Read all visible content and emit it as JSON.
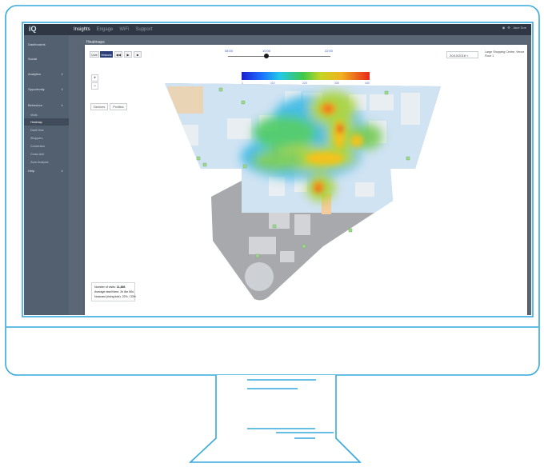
{
  "topbar": {
    "logo": "iQ",
    "nav": [
      "Insights",
      "Engage",
      "WiFi",
      "Support"
    ],
    "active_nav": "Insights",
    "user": "Jane Doe"
  },
  "sidebar": {
    "items": [
      {
        "label": "Dashboards",
        "chevron": ""
      },
      {
        "label": "Social",
        "chevron": ""
      },
      {
        "label": "Analytics",
        "chevron": "∨"
      },
      {
        "label": "Opportunity",
        "chevron": "∨"
      },
      {
        "label": "Behaviour",
        "chevron": "∧"
      }
    ],
    "sub_items": [
      "Visits",
      "Heatmap",
      "Dwell time",
      "Shoppers",
      "Conversion",
      "Cross-visit",
      "Zone Analysis"
    ],
    "selected_sub": "Heatmap",
    "last_item": {
      "label": "Help",
      "chevron": "∨"
    }
  },
  "content": {
    "page_title": "Heatmaps"
  },
  "controls": {
    "live_label": "Live",
    "historic_label": "Historic",
    "rewind_icon": "◀◀",
    "play_icon": "▶",
    "stop_icon": "■",
    "zoom_in": "+",
    "zoom_out": "−",
    "mode_a": "Devices",
    "mode_b": "Profiles"
  },
  "timeline": {
    "start": "08:00",
    "current": "10:00",
    "end": "22:00",
    "position": 0.375
  },
  "scale": {
    "ticks": [
      "1",
      "110",
      "220",
      "330",
      "440"
    ],
    "colors": [
      "#1b1fcf",
      "#1d6cff",
      "#22c9e8",
      "#3ec84a",
      "#c7d522",
      "#f1b11f",
      "#e8261a"
    ]
  },
  "filters": {
    "date": "20/10/2018",
    "venue_line1": "Large Shopping Centre, Venue",
    "venue_line2": "Floor 1"
  },
  "stats": {
    "visits_label": "Number of visits:",
    "visits_value": "11,836",
    "dwell_label": "Average dwell time:",
    "dwell_value": "2h 8m 50s",
    "pass_label": "Nowcast (rising tide):",
    "pass_value": "22% / 33%"
  }
}
